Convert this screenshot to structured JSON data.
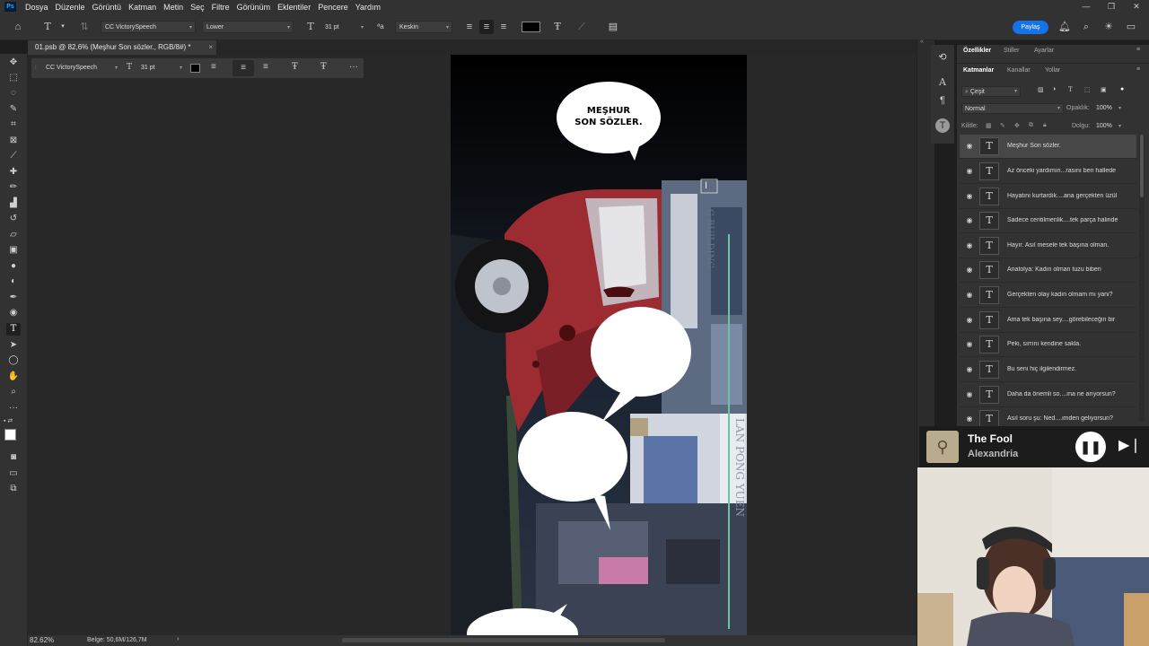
{
  "app": {
    "logo": "Ps"
  },
  "menu": [
    "Dosya",
    "Düzenle",
    "Görüntü",
    "Katman",
    "Metin",
    "Seç",
    "Filtre",
    "Görünüm",
    "Eklentiler",
    "Pencere",
    "Yardım"
  ],
  "options": {
    "font_family": "CC VictorySpeech",
    "font_style": "Lower",
    "font_size": "31 pt",
    "aa_label": "ªa",
    "antialias": "Keskin",
    "share": "Paylaş",
    "text_color": "#000000"
  },
  "document_tab": {
    "title": "01.psb @ 82,6% (Meşhur  Son sözler., RGB/8#) *",
    "close": "×"
  },
  "float_bar": {
    "font_family": "CC VictorySpeech",
    "font_size": "31 pt",
    "more": "···"
  },
  "canvas": {
    "bubble_text": "MEŞHUR\nSON SÖZLER.",
    "sign_1": "G BUILDING",
    "sign_2": "LAN PONG YUEN"
  },
  "status": {
    "zoom": "82.62%",
    "doc_info": "Belge: 50,6M/126,7M",
    "arrow": "›"
  },
  "panel": {
    "top_tabs": [
      "Özellikler",
      "Stiller",
      "Ayarlar"
    ],
    "layer_tabs": [
      "Katmanlar",
      "Kanallar",
      "Yollar"
    ],
    "filter": "Çeşit",
    "blend_mode": "Normal",
    "opacity_label": "Opaklık:",
    "opacity_value": "100%",
    "lock_label": "Kilitle:",
    "fill_label": "Dolgu:",
    "fill_value": "100%",
    "layers": [
      "Meşhur  Son sözler.",
      "Az önceki yardımın...rasını ben hallede",
      "Hayatını kurtardık....ana gerçekten üzül",
      "Sadece centilmenlik....tek parça halinde",
      "Hayır. Asıl mesele tek başına olman.",
      "Anatolya: Kadın olman tuzu biberi",
      "Gerçekten olay kadın olmam mı yani?",
      "Ama tek başına sey....görebileceğin bir",
      "Peki, sırrını kendine sakla.",
      "Bu seni hiç ilgilendirmez.",
      "Daha da önemli  so....ına ne arıyorsun?",
      "Asıl soru şu:  Ned....imden geliyorsun?"
    ]
  },
  "music": {
    "title": "The Fool",
    "artist": "Alexandria"
  },
  "colors": {
    "accent": "#1473e6",
    "panel_bg": "#323232",
    "menubar_bg": "#323232"
  }
}
